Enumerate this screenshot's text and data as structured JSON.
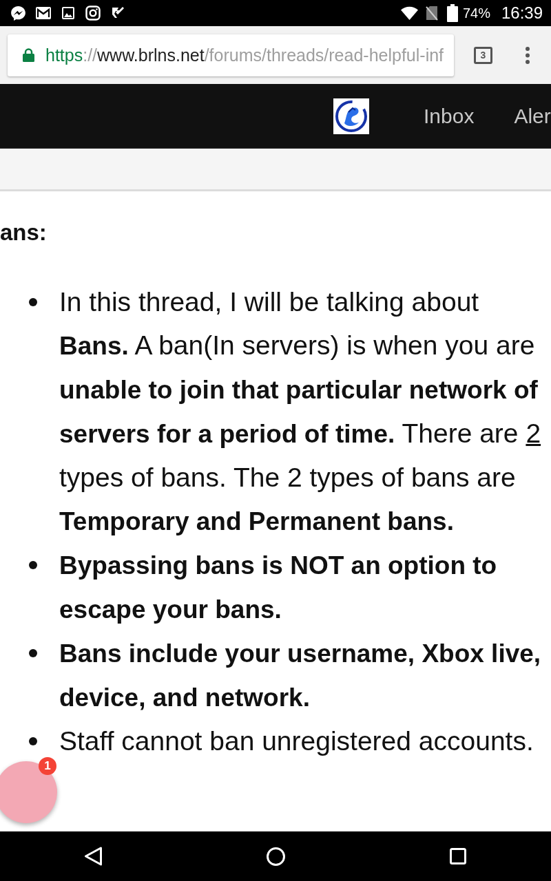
{
  "status_bar": {
    "battery": "74%",
    "time": "16:39"
  },
  "browser": {
    "url": {
      "scheme": "https",
      "separator": "://",
      "host": "www.brlns.net",
      "path": "/forums/threads/read-helpful-inf"
    },
    "tab_count": "3"
  },
  "site_header": {
    "nav_items": [
      {
        "label": "Inbox"
      },
      {
        "label": "Aler"
      }
    ]
  },
  "post": {
    "heading": "ans:",
    "bullets": [
      {
        "segments": [
          {
            "text": "In this thread, I will be talking about ",
            "kind": "plain"
          },
          {
            "text": "Bans.",
            "kind": "bold"
          },
          {
            "text": " A ban(In servers) is when you are ",
            "kind": "plain"
          },
          {
            "text": "unable to join that particular network of servers for a period of time.",
            "kind": "bold"
          },
          {
            "text": " There are ",
            "kind": "plain"
          },
          {
            "text": "2",
            "kind": "underlined"
          },
          {
            "text": " types of bans. The 2 types of bans are ",
            "kind": "plain"
          },
          {
            "text": "Temporary and Permanent bans.",
            "kind": "bold"
          }
        ]
      },
      {
        "segments": [
          {
            "text": "Bypassing bans is NOT an option to escape your bans.",
            "kind": "bold"
          }
        ]
      },
      {
        "segments": [
          {
            "text": "Bans include your username, Xbox live, device, and network.",
            "kind": "bold"
          }
        ]
      },
      {
        "segments": [
          {
            "text": "Staff cannot ban unregistered accounts.",
            "kind": "plain"
          }
        ]
      }
    ]
  },
  "chat_head": {
    "badge": "1"
  }
}
